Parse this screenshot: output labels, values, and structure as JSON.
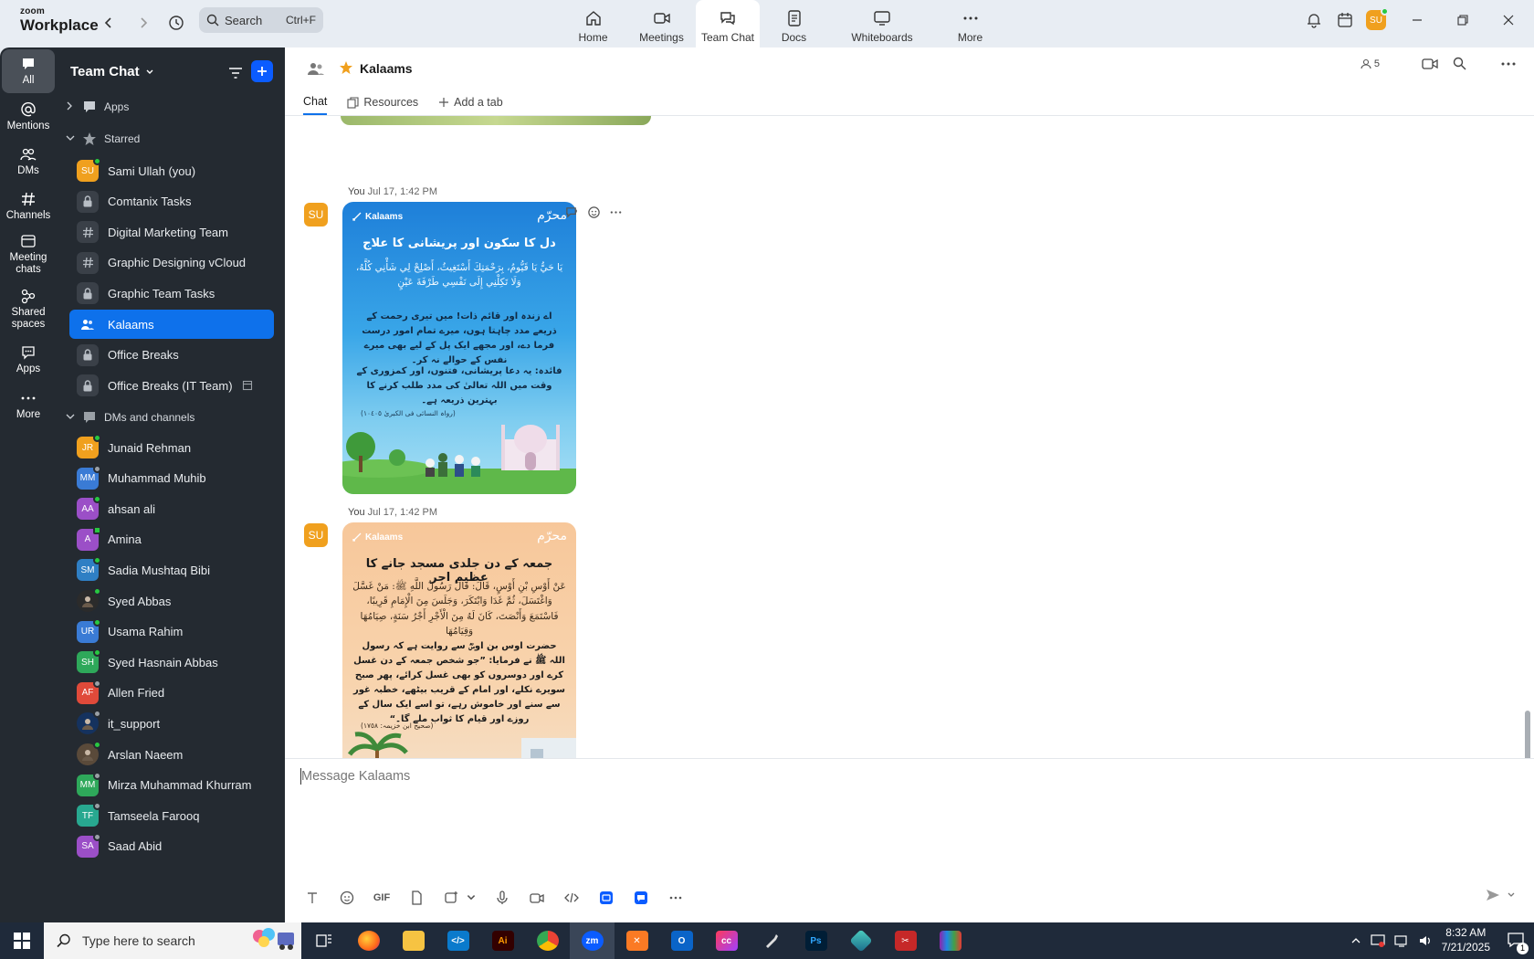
{
  "app": {
    "logo_top": "zoom",
    "logo_bottom": "Workplace"
  },
  "search": {
    "label": "Search",
    "shortcut": "Ctrl+F"
  },
  "nav": [
    {
      "label": "Home",
      "icon": "home-icon"
    },
    {
      "label": "Meetings",
      "icon": "video-icon"
    },
    {
      "label": "Team Chat",
      "icon": "chat-icon"
    },
    {
      "label": "Docs",
      "icon": "doc-icon"
    },
    {
      "label": "Whiteboards",
      "icon": "whiteboard-icon"
    },
    {
      "label": "More",
      "icon": "more-icon"
    }
  ],
  "user": {
    "initials": "SU"
  },
  "rail": [
    {
      "label": "All"
    },
    {
      "label": "Mentions"
    },
    {
      "label": "DMs"
    },
    {
      "label": "Channels"
    },
    {
      "label": "Meeting chats"
    },
    {
      "label": "Shared spaces"
    },
    {
      "label": "Apps"
    },
    {
      "label": "More"
    }
  ],
  "sidebar": {
    "title": "Team Chat",
    "sections": {
      "apps": "Apps",
      "starred": "Starred",
      "dms": "DMs and channels"
    },
    "starred": [
      {
        "label": "Sami Ullah (you)",
        "initials": "SU",
        "color": "#f0a01e",
        "status": "on",
        "kind": "avatar"
      },
      {
        "label": "Comtanix Tasks",
        "kind": "lock"
      },
      {
        "label": "Digital Marketing Team",
        "kind": "hash"
      },
      {
        "label": "Graphic Designing vCloud",
        "kind": "hash"
      },
      {
        "label": "Graphic Team Tasks",
        "kind": "lock"
      },
      {
        "label": "Kalaams",
        "kind": "group",
        "active": true
      },
      {
        "label": "Office Breaks",
        "kind": "lock"
      },
      {
        "label": "Office Breaks (IT Team)",
        "kind": "lock"
      }
    ],
    "dms": [
      {
        "label": "Junaid Rehman",
        "initials": "JR",
        "color": "#f0a01e",
        "status": "on"
      },
      {
        "label": "Muhammad Muhib",
        "initials": "MM",
        "color": "#3a7bd5",
        "status": "off"
      },
      {
        "label": "ahsan ali",
        "initials": "AA",
        "color": "#9b4fc7",
        "status": "on"
      },
      {
        "label": "Amina",
        "initials": "A",
        "color": "#9b4fc7",
        "status": "sq"
      },
      {
        "label": "Sadia Mushtaq Bibi",
        "initials": "SM",
        "color": "#2f7fc4",
        "status": "on"
      },
      {
        "label": "Syed Abbas",
        "initials": "",
        "color": "#2b2b2b",
        "status": "on"
      },
      {
        "label": "Usama Rahim",
        "initials": "UR",
        "color": "#3a7bd5",
        "status": "on"
      },
      {
        "label": "Syed Hasnain Abbas",
        "initials": "SH",
        "color": "#2ea85a",
        "status": "on"
      },
      {
        "label": "Allen Fried",
        "initials": "AF",
        "color": "#e04a3a",
        "status": "off"
      },
      {
        "label": "it_support",
        "initials": "",
        "color": "#15325e",
        "status": "off"
      },
      {
        "label": "Arslan Naeem",
        "initials": "",
        "color": "#5a4a3a",
        "status": "on"
      },
      {
        "label": "Mirza Muhammad Khurram",
        "initials": "MM",
        "color": "#2ea85a",
        "status": "off"
      },
      {
        "label": "Tamseela Farooq",
        "initials": "TF",
        "color": "#28a890",
        "status": "off"
      },
      {
        "label": "Saad Abid",
        "initials": "SA",
        "color": "#9b4fc7",
        "status": "off"
      }
    ]
  },
  "channel": {
    "name": "Kalaams",
    "members": "5",
    "tabs": [
      "Chat",
      "Resources",
      "Add a tab"
    ]
  },
  "messages": [
    {
      "author": "You",
      "time": "Jul 17, 1:42 PM",
      "card": {
        "brand": "Kalaams",
        "logo": "محرّم",
        "title": "دل کا سکون اور پریشانی کا علاج",
        "arabic": "يَا حَيُّ يَا قَيُّومُ، بِرَحْمَتِكَ أَسْتَغِيثُ، أَصْلِحْ لِي شَأْنِي كُلَّهُ، وَلَا تَكِلْنِي إِلَى نَفْسِي طَرْفَةَ عَيْنٍ",
        "urdu": "اے زندہ اور قائم ذات! میں تیری رحمت کے ذریعے مدد چاہتا ہوں، میرے تمام امور درست فرما دے، اور مجھے ایک پل کے لیے بھی میرے نفس کے حوالے نہ کر۔",
        "benefit": "فائدہ: یہ دعا پریشانی، فتنوں، اور کمزوری کے وقت میں اللہ تعالیٰ کی مدد طلب کرنے کا بہترین ذریعہ ہے۔",
        "ref": "(رواہ النسائی فی الکبریٰ ١٠٤٠٥)"
      }
    },
    {
      "author": "You",
      "time": "Jul 17, 1:42 PM",
      "card": {
        "brand": "Kalaams",
        "logo": "محرّم",
        "title": "جمعہ کے دن جلدی مسجد جانے کا عظیم اجر",
        "arabic": "عَنْ أَوْسِ بْنِ أَوْسٍ، قَالَ: قَالَ رَسُولُ اللَّهِ ﷺ: مَنْ غَسَّلَ وَاغْتَسَلَ، ثُمَّ غَدَا وَابْتَكَرَ، وَجَلَسَ مِنَ الْإِمَامِ قَرِيبًا، فَاسْتَمَعَ وَأَنْصَتَ، كَانَ لَهُ مِنَ الْأَجْرِ أَجْرُ سَنَةٍ، صِيَامُهَا وَقِيَامُهَا",
        "urdu": "حضرت اوس بن اوسؓ سے روایت ہے کہ رسول اللہ ﷺ نے فرمایا: ”جو شخص جمعہ کے دن غسل کرے اور دوسروں کو بھی غسل کرائے، پھر صبح سویرے نکلے، اور امام کے قریب بیٹھے، خطبہ غور سے سنے اور خاموش رہے، تو اسے ایک سال کے روزے اور قیام کا ثواب ملے گا۔“",
        "ref": "(صحیح ابن خزیمہ: ١٧٥٨)"
      }
    }
  ],
  "composer": {
    "placeholder": "Message Kalaams",
    "gif": "GIF"
  },
  "taskbar": {
    "search": "Type here to search",
    "time": "8:32 AM",
    "date": "7/21/2025",
    "notif": "1"
  }
}
